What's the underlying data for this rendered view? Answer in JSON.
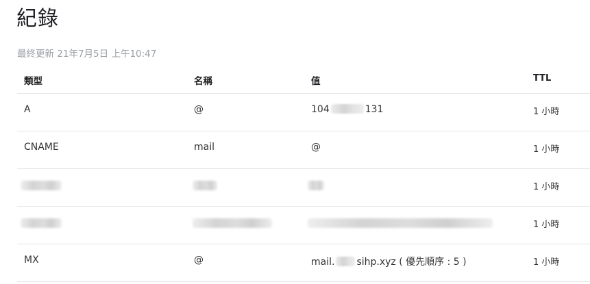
{
  "page": {
    "title": "紀錄",
    "last_updated": "最終更新 21年7月5日 上午10:47"
  },
  "table": {
    "headers": {
      "type": "類型",
      "name": "名稱",
      "value": "值",
      "ttl": "TTL"
    },
    "rows": [
      {
        "type": "A",
        "name": "@",
        "value_prefix": "104",
        "value_suffix": "131",
        "ttl": "1 小時"
      },
      {
        "type": "CNAME",
        "name": "mail",
        "value": "@",
        "ttl": "1 小時"
      },
      {
        "ttl": "1 小時"
      },
      {
        "ttl": "1 小時"
      },
      {
        "type": "MX",
        "name": "@",
        "value_prefix": "mail.",
        "value_suffix": "sihp.xyz ( 優先順序 : 5 )",
        "ttl": "1 小時"
      }
    ]
  }
}
